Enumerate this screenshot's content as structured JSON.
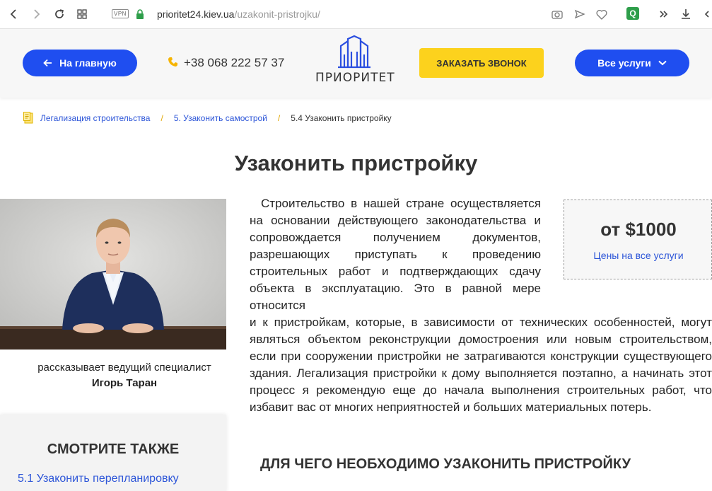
{
  "browser": {
    "vpn": "VPN",
    "url_host": "prioritet24.kiev.ua",
    "url_path": "/uzakonit-pristrojku/",
    "ext_badge": "Q"
  },
  "header": {
    "home_label": "На главную",
    "phone": "+38 068 222 57 37",
    "logo_text": "ПРИОРИТЕТ",
    "call_label": "ЗАКАЗАТЬ ЗВОНОК",
    "services_label": "Все услуги"
  },
  "breadcrumb": {
    "items": [
      "Легализация строительства",
      "5. Узаконить самострой"
    ],
    "current": "5.4 Узаконить пристройку",
    "separator": "/"
  },
  "page": {
    "title": "Узаконить пристройку",
    "caption": "рассказывает ведущий специалист",
    "author": "Игорь Таран",
    "paragraph_part1": "Строительство в нашей стране осуществляется на основании действующего законодательства и сопровождается получением документов, разрешающих приступать к проведению строительных работ и подтверждающих сдачу объекта в эксплуатацию. Это в равной мере относится",
    "paragraph_part2": "и к пристройкам, которые, в зависимости от технических особенностей, могут являться объектом реконструкции домостроения или новым строительством, если при сооружении пристройки не затрагиваются конструкции существующего здания. Легализация пристройки к дому выполняется поэтапно, а начинать этот процесс я рекомендую еще до начала выполнения строительных работ, что избавит вас от многих неприятностей и больших материальных потерь.",
    "subtitle": "ДЛЯ ЧЕГО НЕОБХОДИМО УЗАКОНИТЬ ПРИСТРОЙКУ"
  },
  "price_box": {
    "price": "от $1000",
    "link": "Цены на все услуги"
  },
  "see_also": {
    "title": "СМОТРИТЕ ТАКЖЕ",
    "link": "5.1 Узаконить перепланировку"
  },
  "colors": {
    "brand_blue": "#1f4ef0",
    "accent_yellow": "#fcd21d",
    "link_blue": "#2c55d8"
  }
}
